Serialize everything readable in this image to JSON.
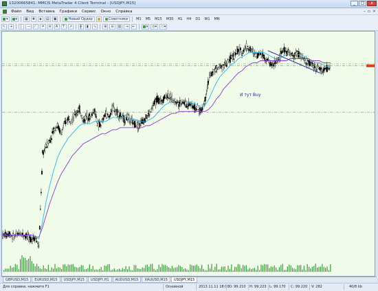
{
  "window": {
    "title": "13200665841: MMCIS MetaTrader 4 Client Terminal - [USDJPY,M15]",
    "min": "_",
    "max": "□",
    "close": "x"
  },
  "menu": [
    "Файл",
    "Вид",
    "Вставка",
    "Графики",
    "Сервис",
    "Окно",
    "Справка"
  ],
  "toolbar": {
    "new_order": "Новый Ордер",
    "experts": "Советники",
    "timeframes": [
      "M1",
      "M5",
      "M15",
      "M30",
      "H1",
      "H4",
      "D1",
      "W1",
      "MN"
    ]
  },
  "chart": {
    "symbol": "USDJPY,M15",
    "annotation": "И тут Buy",
    "colors": {
      "background": "#f1fbe9",
      "candles": "#000000",
      "ma_fast": "#2ab5e8",
      "ma_slow": "#8a36c4",
      "trendline": "#1b1fb0",
      "level_line": "#d9531e",
      "level_line_green": "#6cb36a",
      "volumes": "#3a9a3a",
      "price_marker": "#e0401a"
    }
  },
  "chart_data": {
    "type": "candlestick",
    "instrument": "USDJPY",
    "timeframe": "M15",
    "series": [
      {
        "name": "price",
        "values": [
          8,
          8,
          9,
          7,
          8,
          9,
          8,
          7,
          6,
          7,
          2,
          48,
          52,
          55,
          60,
          62,
          58,
          63,
          66,
          65,
          68,
          70,
          64,
          67,
          66,
          70,
          62,
          63,
          68,
          66,
          71,
          69,
          67,
          65,
          66,
          64,
          63,
          62,
          64,
          66,
          68,
          72,
          75,
          74,
          76,
          77,
          75,
          74,
          73,
          74,
          72,
          73,
          71,
          70,
          69,
          75,
          85,
          88,
          90,
          91,
          92,
          93,
          95,
          97,
          99,
          98,
          101,
          100,
          98,
          97,
          98,
          96,
          94,
          92,
          93,
          95,
          99,
          99,
          97,
          96,
          98,
          96,
          94,
          93,
          92,
          91,
          90,
          89,
          90,
          91
        ]
      },
      {
        "name": "ma_fast",
        "values": [
          8,
          8,
          8,
          8,
          8,
          8,
          8,
          8,
          7,
          7,
          6,
          15,
          25,
          33,
          40,
          46,
          50,
          53,
          56,
          58,
          60,
          62,
          63,
          63,
          63,
          64,
          64,
          64,
          64,
          65,
          66,
          66,
          66,
          66,
          66,
          65,
          65,
          64,
          64,
          64,
          65,
          66,
          68,
          70,
          72,
          73,
          74,
          74,
          74,
          74,
          74,
          73,
          73,
          72,
          71,
          72,
          75,
          79,
          83,
          86,
          88,
          90,
          92,
          93,
          95,
          96,
          97,
          98,
          98,
          98,
          98,
          98,
          97,
          96,
          95,
          95,
          96,
          97,
          97,
          97,
          97,
          97,
          96,
          95,
          94,
          93,
          93,
          92,
          91,
          91
        ]
      },
      {
        "name": "ma_slow",
        "values": [
          8,
          8,
          8,
          8,
          8,
          8,
          8,
          8,
          8,
          7,
          7,
          12,
          18,
          24,
          29,
          34,
          38,
          41,
          44,
          47,
          49,
          51,
          53,
          54,
          55,
          56,
          57,
          58,
          58,
          59,
          60,
          60,
          61,
          61,
          61,
          61,
          61,
          61,
          61,
          62,
          62,
          63,
          64,
          65,
          66,
          67,
          68,
          68,
          69,
          69,
          69,
          69,
          69,
          69,
          69,
          69,
          70,
          72,
          75,
          77,
          80,
          82,
          84,
          86,
          88,
          89,
          91,
          92,
          93,
          93,
          94,
          94,
          94,
          94,
          94,
          94,
          94,
          94,
          95,
          95,
          95,
          95,
          95,
          95,
          94,
          94,
          94,
          93,
          93,
          93
        ]
      }
    ],
    "levels": [
      {
        "name": "level-top",
        "value": 92.5
      },
      {
        "name": "level-mid",
        "value": 91.5
      },
      {
        "name": "level-low",
        "value": 68.5
      }
    ],
    "ylim": [
      0,
      105
    ]
  },
  "symbol_tabs": [
    "GBPUSD,M15",
    "EURUSD,M15",
    "USDJPY,M15",
    "USDJPY,H1",
    "AUDUSD,M15",
    "XAUUSD,M15",
    "USDJPY,M15"
  ],
  "active_tab_index": 6,
  "status": {
    "help": "Для справки, нажмите F1",
    "profile": "Основной",
    "datetime": "2013.11.11 18:00",
    "open": "O: 99.210",
    "high": "H: 99.223",
    "low": "L: 99.170",
    "closeval": "C: 99.220",
    "volume": "V: 282",
    "traffic": "40/8 kb"
  }
}
